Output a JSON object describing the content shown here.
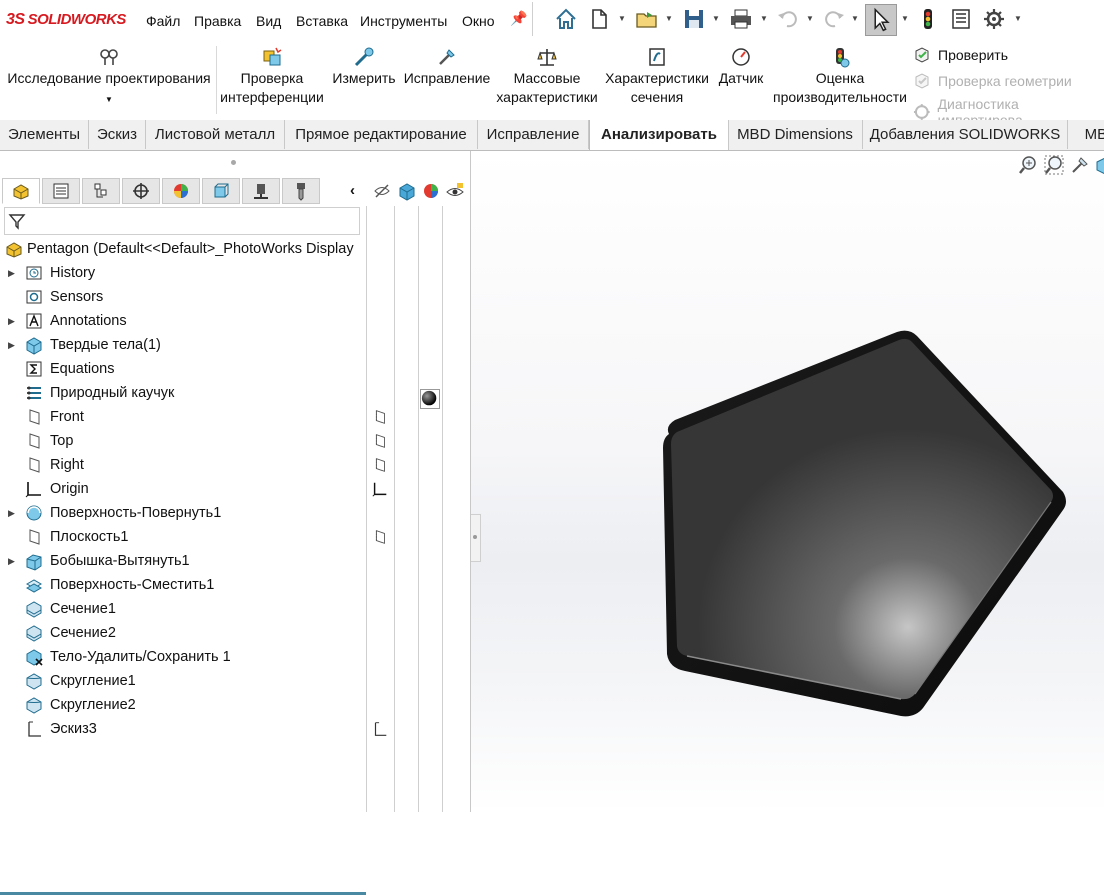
{
  "app": {
    "logo_prefix": "3S",
    "logo_bold": "SOLID",
    "logo_rest": "WORKS"
  },
  "menu": [
    "Файл",
    "Правка",
    "Вид",
    "Вставка",
    "Инструменты",
    "Окно"
  ],
  "ribbon": {
    "design_study": "Исследование проектирования",
    "interference": [
      "Проверка",
      "интерференции"
    ],
    "measure": "Измерить",
    "fix": "Исправление",
    "mass_props": [
      "Массовые",
      "характеристики"
    ],
    "section_props": [
      "Характеристики",
      "сечения"
    ],
    "sensor": "Датчик",
    "performance": [
      "Оценка",
      "производительности"
    ],
    "check": "Проверить",
    "geometry_check": "Проверка геометрии",
    "import_diag": "Диагностика импортирова"
  },
  "tabs": [
    "Элементы",
    "Эскиз",
    "Листовой металл",
    "Прямое редактирование",
    "Исправление",
    "Анализировать",
    "MBD Dimensions",
    "Добавления SOLIDWORKS",
    "MBI"
  ],
  "active_tab": "Анализировать",
  "tree": {
    "root": "Pentagon  (Default<<Default>_PhotoWorks Display",
    "items": [
      "History",
      "Sensors",
      "Annotations",
      "Твердые тела(1)",
      "Equations",
      "Природный каучук",
      "Front",
      "Top",
      "Right",
      "Origin",
      "Поверхность-Повернуть1",
      "Плоскость1",
      "Бобышка-Вытянуть1",
      "Поверхность-Сместить1",
      "Сечение1",
      "Сечение2",
      "Тело-Удалить/Сохранить 1",
      "Скругление1",
      "Скругление2",
      "Эскиз3"
    ]
  },
  "colors": {
    "brand": "#d71920",
    "rollback_bar": "#4a89a2",
    "model_fill": "#3a3a3a"
  },
  "icons": {
    "feature_manager": "feature-manager-icon",
    "property_manager": "property-manager-icon",
    "configuration": "configuration-manager-icon",
    "dimxpert": "dimxpert-icon",
    "display": "display-manager-icon"
  }
}
